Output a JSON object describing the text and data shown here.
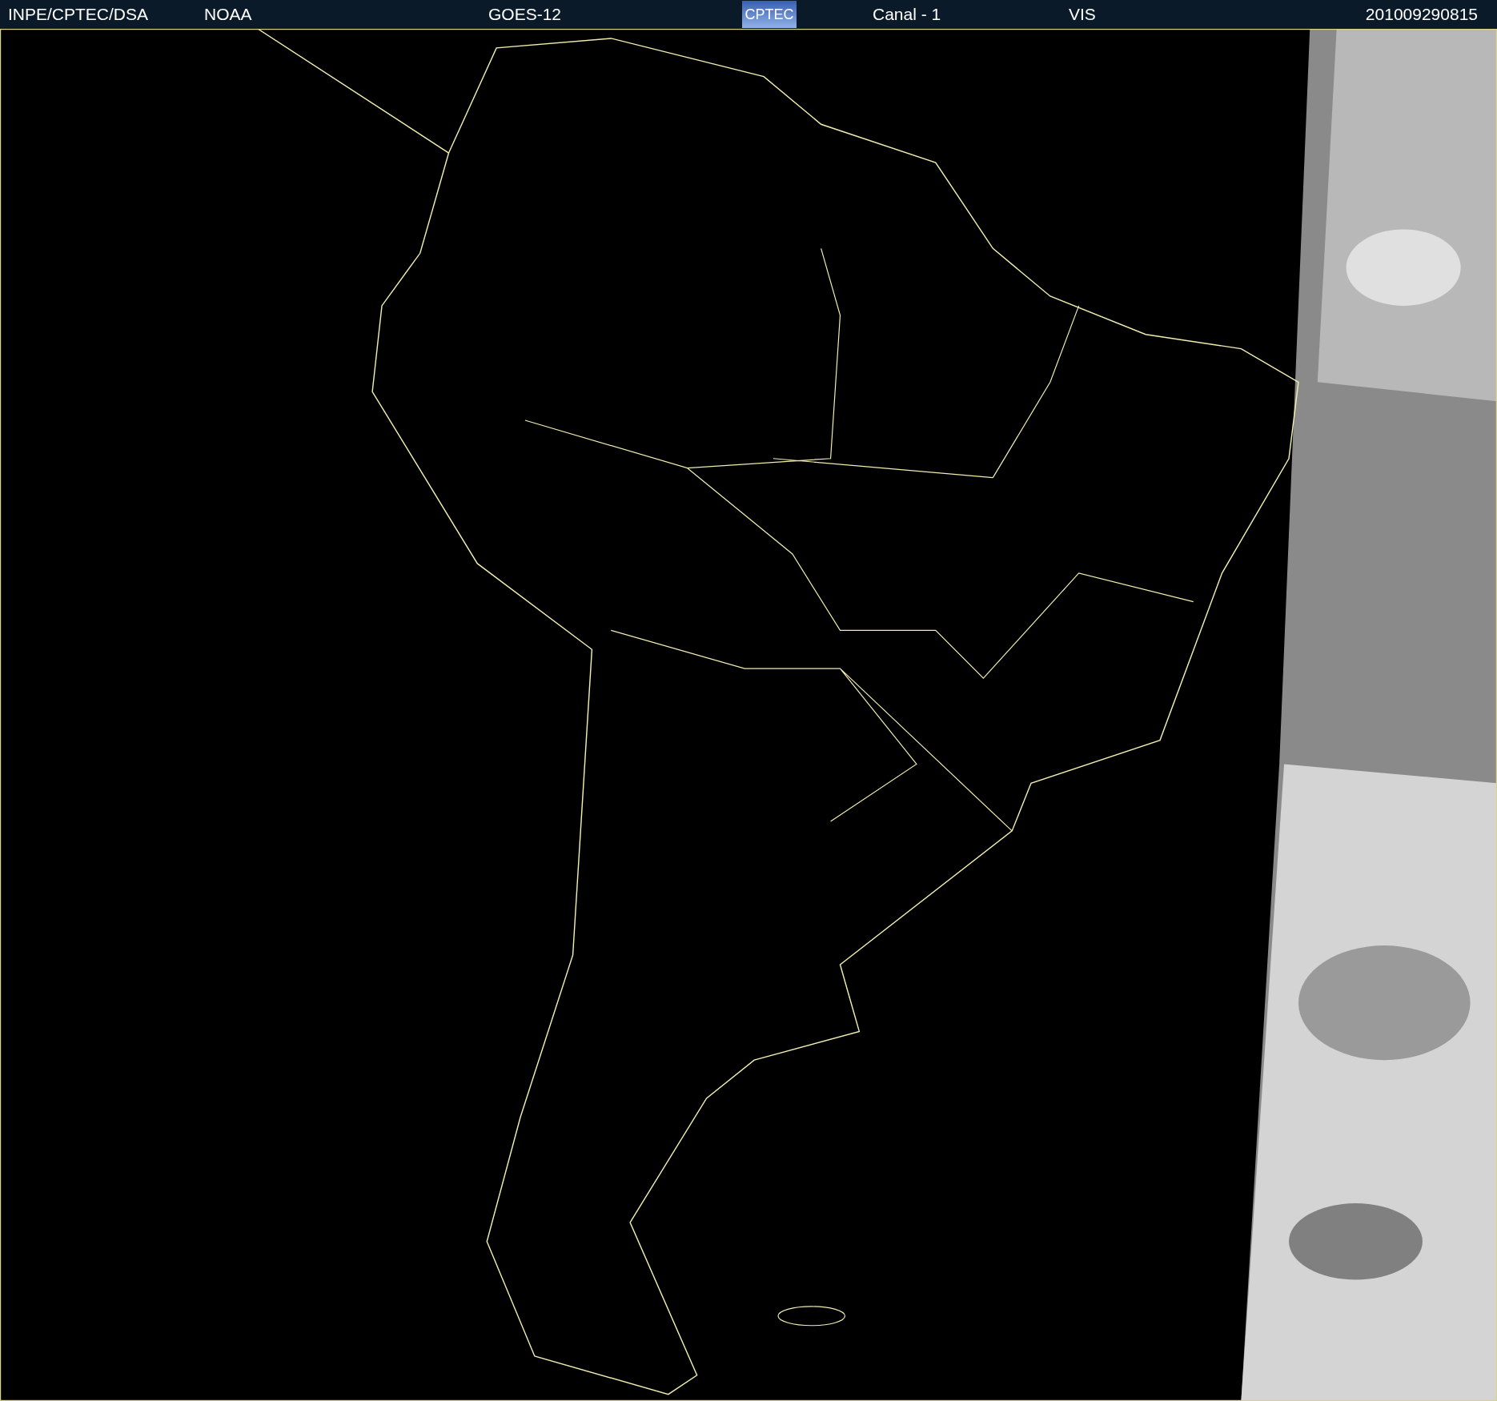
{
  "header": {
    "items": [
      {
        "text": "INPE/CPTEC/DSA",
        "kind": "text"
      },
      {
        "text": "NOAA",
        "kind": "text"
      },
      {
        "text": "GOES-12",
        "kind": "text"
      },
      {
        "text": "CPTEC",
        "kind": "logo"
      },
      {
        "text": "Canal - 1",
        "kind": "text"
      },
      {
        "text": "VIS",
        "kind": "text"
      },
      {
        "text": "201009290815",
        "kind": "text"
      }
    ]
  }
}
